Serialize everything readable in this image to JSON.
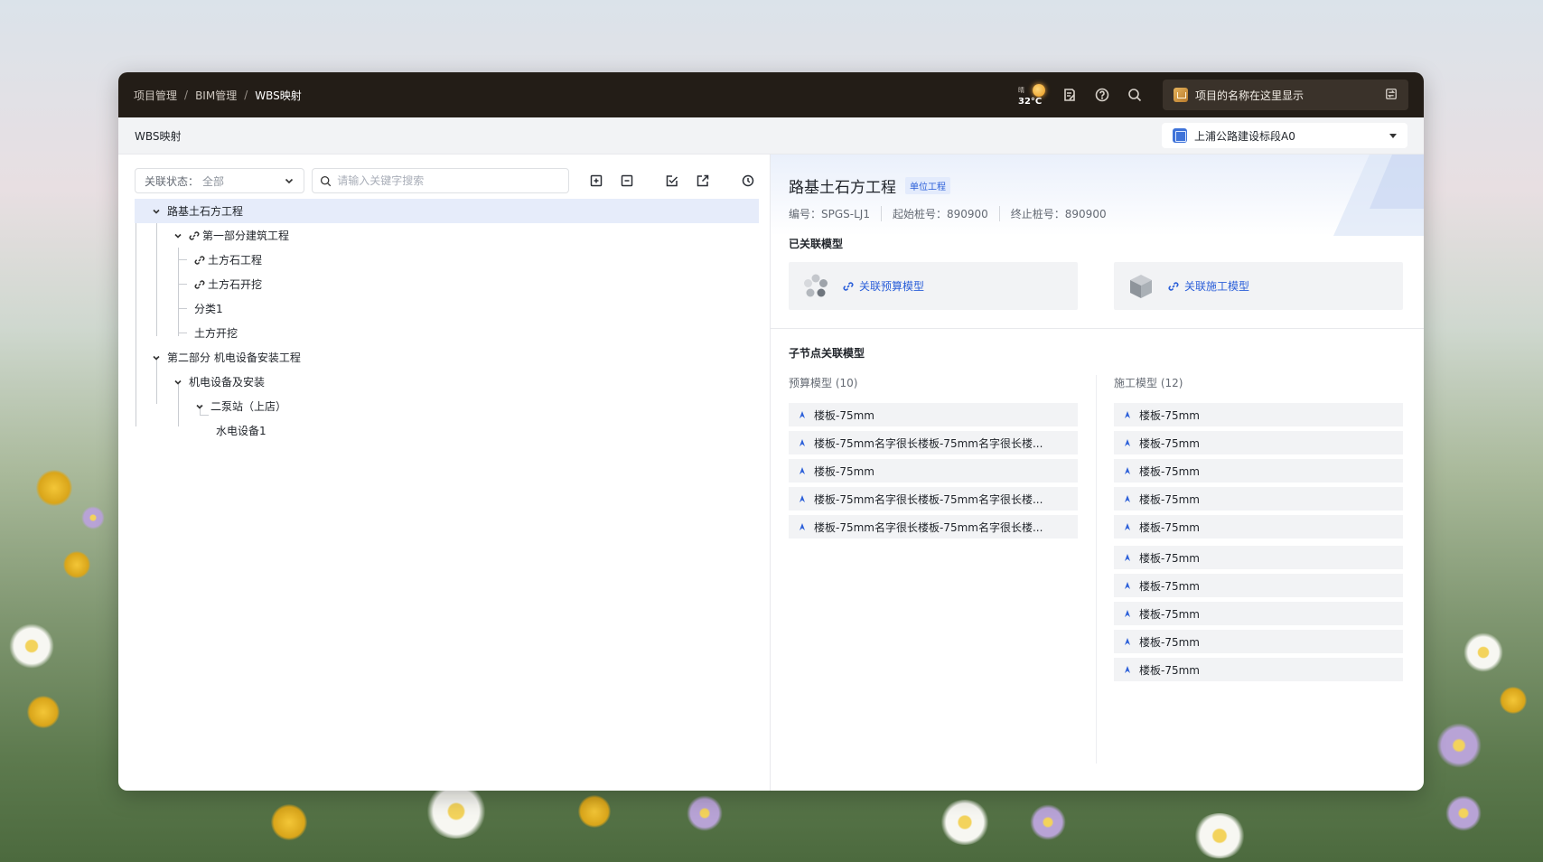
{
  "breadcrumb": {
    "items": [
      "项目管理",
      "BIM管理",
      "WBS映射"
    ],
    "separator": "/"
  },
  "topbar": {
    "weather_condition": "晴",
    "weather_temp": "32°C",
    "project_name": "项目的名称在这里显示"
  },
  "subheader": {
    "page_title": "WBS映射",
    "section_name": "上浦公路建设标段A0"
  },
  "filter": {
    "status_label": "关联状态：",
    "status_value": "全部",
    "search_placeholder": "请输入关键字搜索"
  },
  "tree": {
    "nodes": [
      {
        "label": "路基土石方工程"
      },
      {
        "label": "第一部分建筑工程"
      },
      {
        "label": "土方石工程"
      },
      {
        "label": "土方石开挖"
      },
      {
        "label": "分类1"
      },
      {
        "label": "土方开挖"
      },
      {
        "label": "第二部分 机电设备安装工程"
      },
      {
        "label": "机电设备及安装"
      },
      {
        "label": "二泵站（上店）"
      },
      {
        "label": "水电设备1"
      }
    ]
  },
  "detail": {
    "title": "路基土石方工程",
    "type_tag": "单位工程",
    "code": "编号：SPGS-LJ1",
    "start_pile": "起始桩号：890900",
    "end_pile": "终止桩号：890900"
  },
  "linked_models": {
    "title": "已关联模型",
    "budget_link": "关联预算模型",
    "construction_link": "关联施工模型"
  },
  "child_models": {
    "title": "子节点关联模型",
    "budget_title": "预算模型 (10)",
    "construction_title": "施工模型 (12)",
    "budget_items": [
      "楼板-75mm",
      "楼板-75mm名字很长楼板-75mm名字很长楼...",
      "楼板-75mm",
      "楼板-75mm名字很长楼板-75mm名字很长楼...",
      "楼板-75mm名字很长楼板-75mm名字很长楼..."
    ],
    "construction_items": [
      "楼板-75mm",
      "楼板-75mm",
      "楼板-75mm",
      "楼板-75mm",
      "楼板-75mm",
      "楼板-75mm",
      "楼板-75mm",
      "楼板-75mm",
      "楼板-75mm",
      "楼板-75mm"
    ]
  },
  "colors": {
    "topbar_bg": "#231d17",
    "accent_blue": "#2b5fd9",
    "selected_row": "#e6ecfa",
    "item_bg": "#f2f3f5"
  },
  "icons": {
    "weather": "sun-icon",
    "notes": "edit-note-icon",
    "help": "help-circle-icon",
    "search": "search-icon",
    "project_switch": "switch-icon",
    "expand_all": "plus-square-icon",
    "collapse_all": "minus-square-icon",
    "batch_check": "check-edit-icon",
    "export": "export-icon",
    "history": "clock-icon",
    "tree_link": "link-icon",
    "model_item": "model-arrow-icon"
  }
}
